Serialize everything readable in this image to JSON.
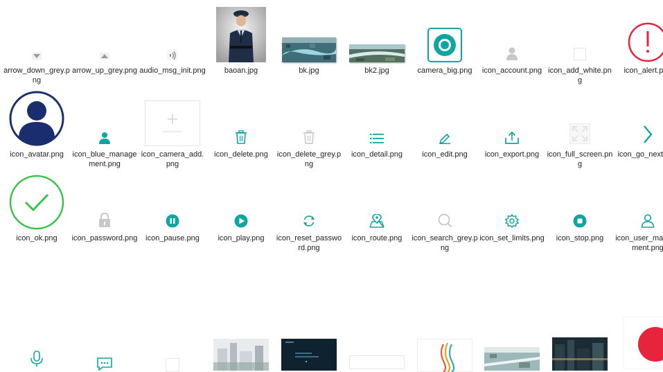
{
  "colors": {
    "teal": "#11a5a2",
    "alert_red": "#e8233c",
    "ok_green": "#39c24a",
    "avatar_navy": "#1a2d6e",
    "light_grey": "#c9c9c9"
  },
  "files": [
    {
      "name": "arrow_down_grey.png",
      "icon": "arrow-down-grey-icon"
    },
    {
      "name": "arrow_up_grey.png",
      "icon": "arrow-up-grey-icon"
    },
    {
      "name": "audio_msg_init.png",
      "icon": "audio-msg-icon"
    },
    {
      "name": "baoan.jpg",
      "icon": "security-guard-photo"
    },
    {
      "name": "bk.jpg",
      "icon": "aerial-city-photo"
    },
    {
      "name": "bk2.jpg",
      "icon": "aerial-river-photo"
    },
    {
      "name": "camera_big.png",
      "icon": "camera-big-icon"
    },
    {
      "name": "icon_account.png",
      "icon": "account-icon"
    },
    {
      "name": "icon_add_white.png",
      "icon": "add-white-icon"
    },
    {
      "name": "icon_alert.png",
      "icon": "alert-icon"
    },
    {
      "name": "icon_avatar.png",
      "icon": "avatar-icon"
    },
    {
      "name": "icon_blue_management.png",
      "icon": "blue-management-icon"
    },
    {
      "name": "icon_camera_add.png",
      "icon": "camera-add-icon"
    },
    {
      "name": "icon_delete.png",
      "icon": "delete-icon"
    },
    {
      "name": "icon_delete_grey.png",
      "icon": "delete-grey-icon"
    },
    {
      "name": "icon_detail.png",
      "icon": "detail-icon"
    },
    {
      "name": "icon_edit.png",
      "icon": "edit-icon"
    },
    {
      "name": "icon_export.png",
      "icon": "export-icon"
    },
    {
      "name": "icon_full_screen.png",
      "icon": "full-screen-icon"
    },
    {
      "name": "icon_go_next.png",
      "icon": "go-next-icon"
    },
    {
      "name": "icon_ok.png",
      "icon": "ok-icon"
    },
    {
      "name": "icon_password.png",
      "icon": "password-icon"
    },
    {
      "name": "icon_pause.png",
      "icon": "pause-icon"
    },
    {
      "name": "icon_play.png",
      "icon": "play-icon"
    },
    {
      "name": "icon_reset_password.png",
      "icon": "reset-password-icon"
    },
    {
      "name": "icon_route.png",
      "icon": "route-icon"
    },
    {
      "name": "icon_search_grey.png",
      "icon": "search-grey-icon"
    },
    {
      "name": "icon_set_limits.png",
      "icon": "set-limits-icon"
    },
    {
      "name": "icon_stop.png",
      "icon": "stop-icon"
    },
    {
      "name": "icon_user_management.png",
      "icon": "user-management-icon"
    }
  ],
  "row4_partial": [
    {
      "icon": "microphone-icon"
    },
    {
      "icon": "chat-icon"
    },
    {
      "icon": "blank-thumbnail"
    },
    {
      "icon": "city-model-photo"
    },
    {
      "icon": "dark-dashboard-thumbnail"
    },
    {
      "icon": "blank-thumbnail"
    },
    {
      "icon": "wave-logo-icon"
    },
    {
      "icon": "aerial-bridge-photo"
    },
    {
      "icon": "city-night-photo"
    },
    {
      "icon": "record-red-icon"
    }
  ]
}
